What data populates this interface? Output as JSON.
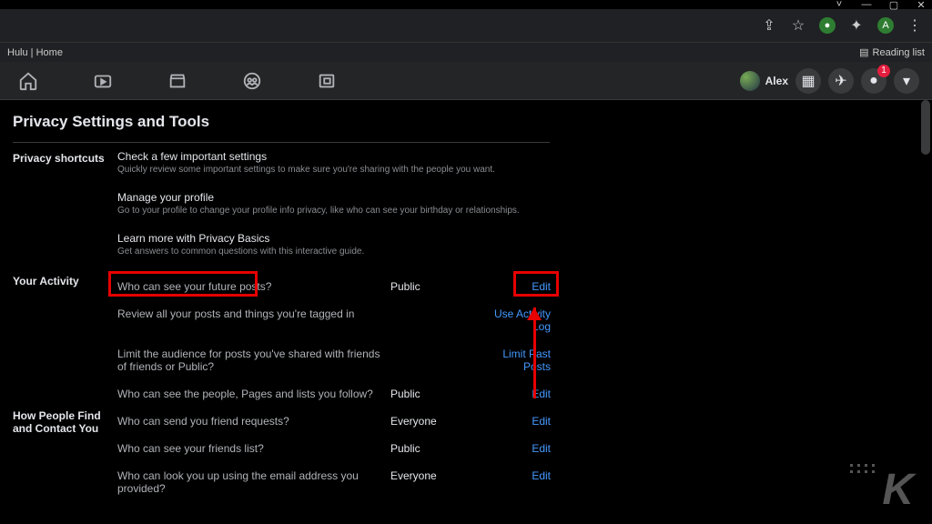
{
  "window": {
    "minimize": "—",
    "maximize": "▢",
    "close": "✕",
    "chevron": "˅"
  },
  "browser": {
    "share": "⇪",
    "star": "☆",
    "ext": "✦",
    "menu": "⋮",
    "profile_initial": "A"
  },
  "bookmarks": {
    "home": "Hulu | Home",
    "reading": "Reading list"
  },
  "fb": {
    "user_name": "Alex",
    "badge": "1",
    "grid": "▦",
    "msg": "✉",
    "bell": "🔔",
    "caret": "▾"
  },
  "page_title": "Privacy Settings and Tools",
  "sections": {
    "shortcuts": {
      "label": "Privacy shortcuts",
      "items": [
        {
          "title": "Check a few important settings",
          "desc": "Quickly review some important settings to make sure you're sharing with the people you want."
        },
        {
          "title": "Manage your profile",
          "desc": "Go to your profile to change your profile info privacy, like who can see your birthday or relationships."
        },
        {
          "title": "Learn more with Privacy Basics",
          "desc": "Get answers to common questions with this interactive guide."
        }
      ]
    },
    "activity": {
      "label": "Your Activity",
      "rows": [
        {
          "q": "Who can see your future posts?",
          "v": "Public",
          "a": "Edit"
        },
        {
          "q": "Review all your posts and things you're tagged in",
          "v": "",
          "a": "Use Activity Log"
        },
        {
          "q": "Limit the audience for posts you've shared with friends of friends or Public?",
          "v": "",
          "a": "Limit Past Posts"
        },
        {
          "q": "Who can see the people, Pages and lists you follow?",
          "v": "Public",
          "a": "Edit"
        }
      ]
    },
    "find": {
      "label": "How People Find and Contact You",
      "rows": [
        {
          "q": "Who can send you friend requests?",
          "v": "Everyone",
          "a": "Edit"
        },
        {
          "q": "Who can see your friends list?",
          "v": "Public",
          "a": "Edit"
        },
        {
          "q": "Who can look you up using the email address you provided?",
          "v": "Everyone",
          "a": "Edit"
        }
      ]
    }
  },
  "watermark": "K"
}
